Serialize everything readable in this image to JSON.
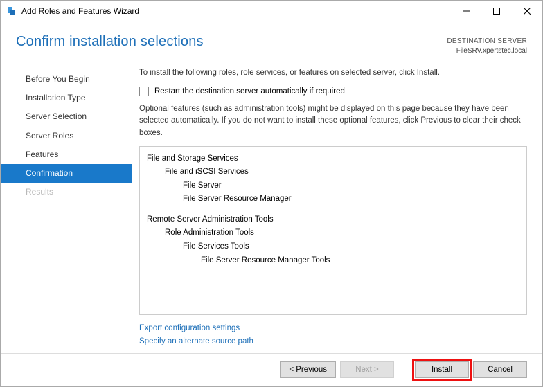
{
  "window": {
    "title": "Add Roles and Features Wizard"
  },
  "header": {
    "page_title": "Confirm installation selections",
    "dest_label": "DESTINATION SERVER",
    "dest_name": "FileSRV.xpertstec.local"
  },
  "nav": {
    "items": [
      {
        "label": "Before You Begin",
        "state": "normal"
      },
      {
        "label": "Installation Type",
        "state": "normal"
      },
      {
        "label": "Server Selection",
        "state": "normal"
      },
      {
        "label": "Server Roles",
        "state": "normal"
      },
      {
        "label": "Features",
        "state": "normal"
      },
      {
        "label": "Confirmation",
        "state": "selected"
      },
      {
        "label": "Results",
        "state": "disabled"
      }
    ]
  },
  "content": {
    "intro": "To install the following roles, role services, or features on selected server, click Install.",
    "restart_checkbox_label": "Restart the destination server automatically if required",
    "restart_checked": false,
    "optional_note": "Optional features (such as administration tools) might be displayed on this page because they have been selected automatically. If you do not want to install these optional features, click Previous to clear their check boxes.",
    "features": [
      {
        "level": 0,
        "label": "File and Storage Services"
      },
      {
        "level": 1,
        "label": "File and iSCSI Services"
      },
      {
        "level": 2,
        "label": "File Server"
      },
      {
        "level": 2,
        "label": "File Server Resource Manager"
      },
      {
        "level": 0,
        "label": "Remote Server Administration Tools",
        "gap": true
      },
      {
        "level": 1,
        "label": "Role Administration Tools"
      },
      {
        "level": 2,
        "label": "File Services Tools"
      },
      {
        "level": 3,
        "label": "File Server Resource Manager Tools"
      }
    ],
    "links": {
      "export": "Export configuration settings",
      "source": "Specify an alternate source path"
    }
  },
  "footer": {
    "previous": "< Previous",
    "next": "Next >",
    "install": "Install",
    "cancel": "Cancel"
  }
}
